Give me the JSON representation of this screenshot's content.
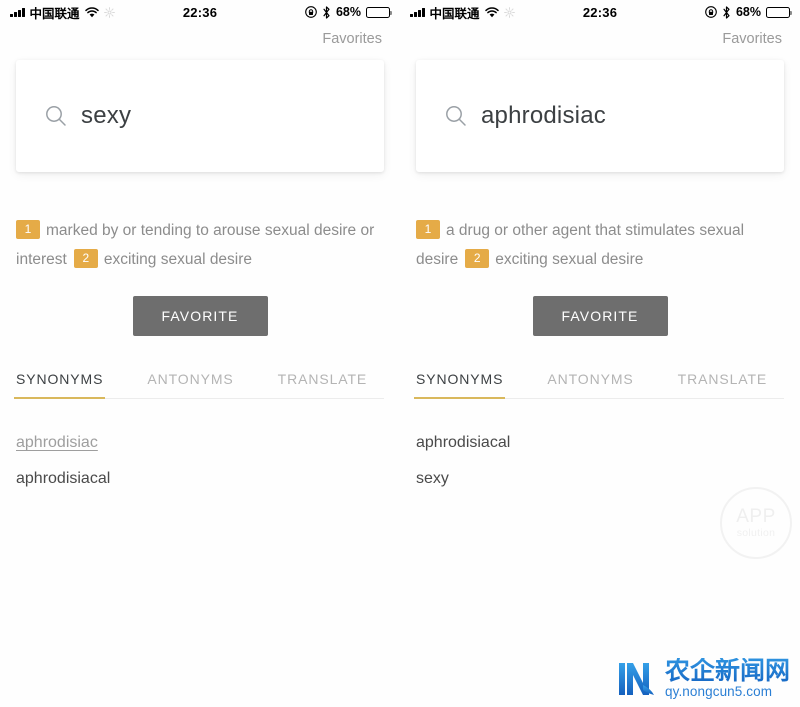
{
  "colors": {
    "badge": "#E5AB47",
    "tab_underline": "#D9B85C",
    "favorite_button": "#6E6E6E",
    "logo_blue": "#2B7FD4"
  },
  "status_bar": {
    "carrier": "中国联通",
    "time": "22:36",
    "battery_percent": "68%",
    "icons": [
      "signal-bars-icon",
      "wifi-icon",
      "sync-icon",
      "rotation-lock-icon",
      "bluetooth-icon",
      "battery-icon"
    ]
  },
  "panels": [
    {
      "nav": {
        "favorites_label": "Favorites"
      },
      "search": {
        "icon": "search-icon",
        "value": "sexy",
        "placeholder": "Search"
      },
      "definitions": [
        {
          "number": "1",
          "text": "marked by or tending to arouse sexual desire or interest"
        },
        {
          "number": "2",
          "text": "exciting sexual desire"
        }
      ],
      "favorite_button_label": "FAVORITE",
      "tabs": [
        {
          "label": "SYNONYMS",
          "active": true
        },
        {
          "label": "ANTONYMS",
          "active": false
        },
        {
          "label": "TRANSLATE",
          "active": false
        }
      ],
      "synonyms": [
        {
          "word": "aphrodisiac",
          "highlighted": true
        },
        {
          "word": "aphrodisiacal",
          "highlighted": false
        }
      ]
    },
    {
      "nav": {
        "favorites_label": "Favorites"
      },
      "search": {
        "icon": "search-icon",
        "value": "aphrodisiac",
        "placeholder": "Search"
      },
      "definitions": [
        {
          "number": "1",
          "text": "a drug or other agent that stimulates sexual desire"
        },
        {
          "number": "2",
          "text": "exciting sexual desire"
        }
      ],
      "favorite_button_label": "FAVORITE",
      "tabs": [
        {
          "label": "SYNONYMS",
          "active": true
        },
        {
          "label": "ANTONYMS",
          "active": false
        },
        {
          "label": "TRANSLATE",
          "active": false
        }
      ],
      "synonyms": [
        {
          "word": "aphrodisiacal",
          "highlighted": false
        },
        {
          "word": "sexy",
          "highlighted": false
        }
      ]
    }
  ],
  "watermarks": {
    "app_solution": {
      "line1": "APP",
      "line2": "solution"
    },
    "site_logo": {
      "name": "农企新闻网",
      "url": "qy.nongcun5.com"
    }
  }
}
